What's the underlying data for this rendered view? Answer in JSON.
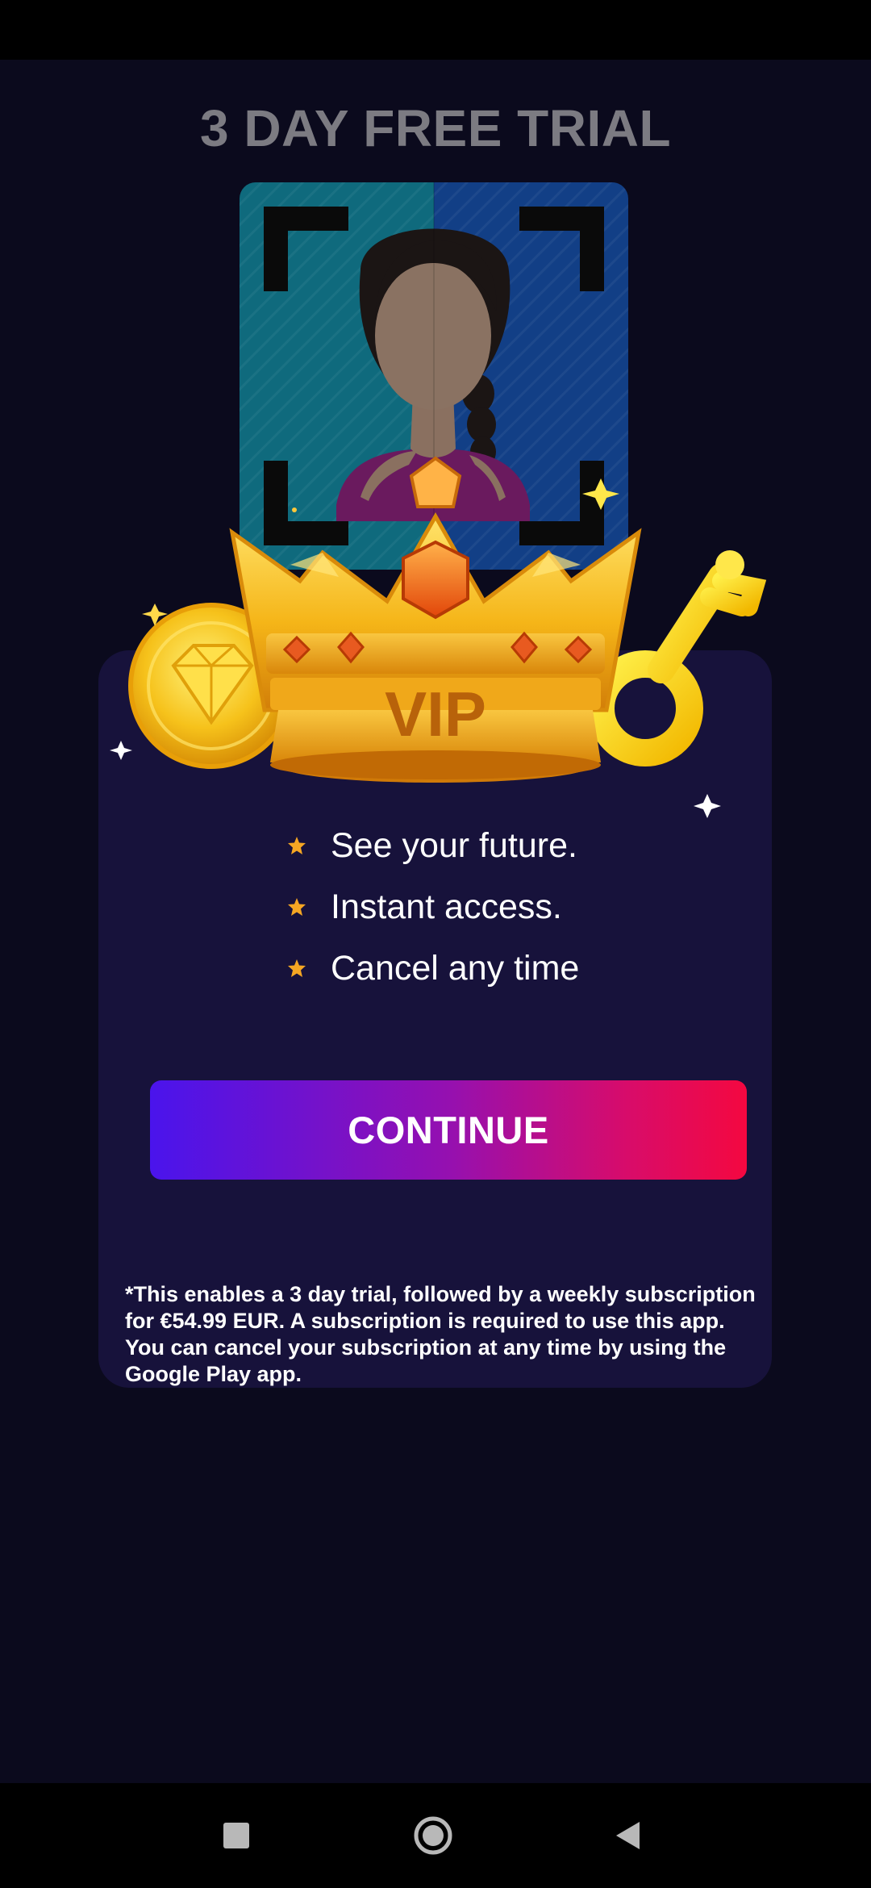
{
  "paywall": {
    "title": "3 DAY FREE TRIAL",
    "badge_text": "VIP",
    "features": [
      {
        "icon": "star-icon",
        "label": "See your future."
      },
      {
        "icon": "star-icon",
        "label": "Instant access."
      },
      {
        "icon": "star-icon",
        "label": "Cancel any time"
      }
    ],
    "continue_label": "CONTINUE",
    "disclaimer": "*This enables a 3 day trial, followed by a weekly subscription for €54.99 EUR. A subscription is required to use this app. You can cancel your subscription at any time by using the Google Play app."
  },
  "colors": {
    "background": "#0b0a1d",
    "panel": "#17123b",
    "title": "#7c7b82",
    "button_gradient_start": "#4a14ec",
    "button_gradient_end": "#f40840",
    "star": "#f5a623"
  },
  "navigation": {
    "buttons": [
      "recents-square-icon",
      "home-circle-icon",
      "back-triangle-icon"
    ]
  }
}
